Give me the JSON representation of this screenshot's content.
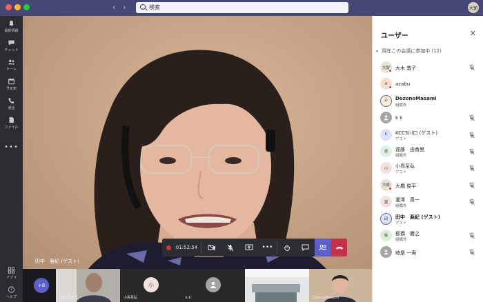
{
  "topbar": {
    "search_placeholder": "検索",
    "avatar_initials": "大郭"
  },
  "rail": [
    {
      "label": "最新情報",
      "icon": "bell-icon"
    },
    {
      "label": "チャット",
      "icon": "chat-icon"
    },
    {
      "label": "チーム",
      "icon": "teams-icon"
    },
    {
      "label": "予定表",
      "icon": "calendar-icon"
    },
    {
      "label": "通話",
      "icon": "phone-icon"
    },
    {
      "label": "ファイル",
      "icon": "file-icon"
    },
    {
      "label": "",
      "icon": "more-icon"
    },
    {
      "label": "アプリ",
      "icon": "apps-icon"
    },
    {
      "label": "ヘルプ",
      "icon": "help-icon"
    }
  ],
  "stage": {
    "speaker_label": "田中　亜紀 (ゲスト)"
  },
  "controls": {
    "timer": "01:52:54"
  },
  "strip": {
    "more_count": "+8",
    "tiles": [
      {
        "name": "遠藤 由香里"
      },
      {
        "name": "小島至弘",
        "initial": "小"
      },
      {
        "name": "k k"
      },
      {
        "name": ""
      },
      {
        "name": "DozonoMasami"
      }
    ]
  },
  "panel": {
    "title": "ユーザー",
    "section": "現在この会議に参加中 (12)",
    "participants": [
      {
        "name": "大木 敦子",
        "initials": "大智",
        "avatar_color": "#e8e3d7",
        "subtitle": "",
        "presence": true,
        "bold": false,
        "muted": true
      },
      {
        "name": "azabu",
        "initials": "A",
        "avatar_color": "#f5dfcf",
        "subtitle": "",
        "presence": true,
        "bold": false,
        "muted": false
      },
      {
        "name": "DozonoMasami",
        "initials": "D",
        "avatar_color": "#fcefd4",
        "subtitle": "組織外",
        "presence": false,
        "bold": true,
        "muted": false,
        "ring": true
      },
      {
        "name": "k k",
        "initials": "",
        "avatar_color": "#a5a5a5",
        "subtitle": "",
        "presence": false,
        "bold": false,
        "muted": true
      },
      {
        "name": "KCCS川口 (ゲスト)",
        "initials": "K",
        "avatar_color": "#dde2f5",
        "subtitle": "ゲスト",
        "presence": false,
        "bold": false,
        "muted": true
      },
      {
        "name": "遠藤　由香里",
        "initials": "遠",
        "avatar_color": "#dff0e4",
        "subtitle": "組織外",
        "presence": false,
        "bold": false,
        "muted": true
      },
      {
        "name": "小島至弘",
        "initials": "小",
        "avatar_color": "#f3e3e0",
        "subtitle": "ゲスト",
        "presence": false,
        "bold": false,
        "muted": true
      },
      {
        "name": "大橋 俊平",
        "initials": "大俊",
        "avatar_color": "#e6e0d5",
        "subtitle": "",
        "presence": true,
        "bold": false,
        "muted": true
      },
      {
        "name": "瀧澤　真一",
        "initials": "瀧",
        "avatar_color": "#f1e2de",
        "subtitle": "組織外",
        "presence": false,
        "bold": false,
        "muted": true
      },
      {
        "name": "田中　亜紀 (ゲスト)",
        "initials": "田",
        "avatar_color": "#e2e5f5",
        "subtitle": "ゲスト",
        "presence": false,
        "bold": true,
        "muted": false,
        "ring": true
      },
      {
        "name": "板橋　勝之",
        "initials": "板",
        "avatar_color": "#dbeedd",
        "subtitle": "組織外",
        "presence": false,
        "bold": false,
        "muted": true
      },
      {
        "name": "岐是 一寿",
        "initials": "",
        "avatar_color": "#a5a5a5",
        "subtitle": "",
        "presence": false,
        "bold": false,
        "muted": true
      }
    ]
  }
}
